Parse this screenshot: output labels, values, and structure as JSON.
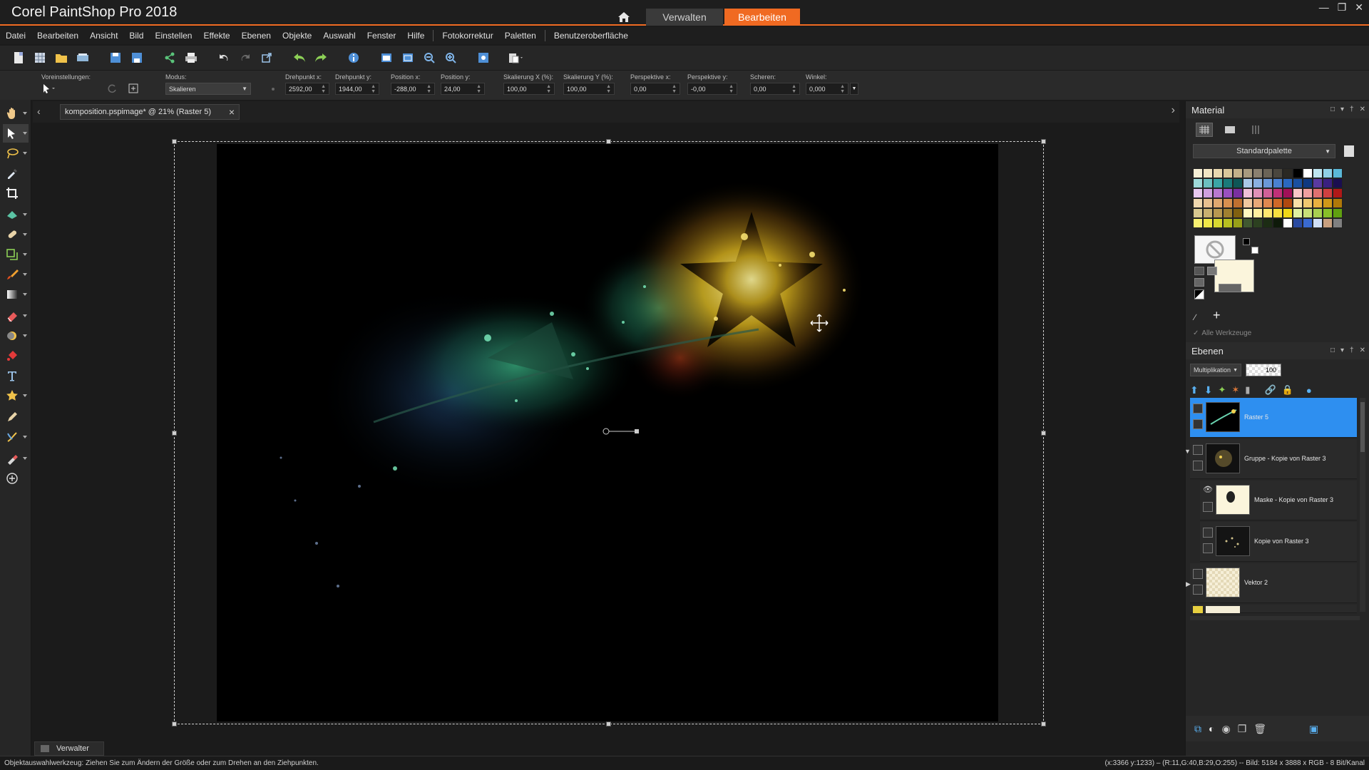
{
  "app": {
    "title": "Corel PaintShop Pro 2018",
    "tabs": [
      {
        "label": "Verwalten"
      },
      {
        "label": "Bearbeiten"
      }
    ],
    "accent_color": "#f06a22"
  },
  "menu": [
    "Datei",
    "Bearbeiten",
    "Ansicht",
    "Bild",
    "Einstellen",
    "Effekte",
    "Ebenen",
    "Objekte",
    "Auswahl",
    "Fenster",
    "Hilfe",
    "Fotokorrektur",
    "Paletten",
    "Benutzeroberfläche"
  ],
  "options": {
    "presets_label": "Voreinstellungen:",
    "mode_label": "Modus:",
    "mode_value": "Skalieren",
    "fields": [
      {
        "label": "Drehpunkt x:",
        "value": "2592,00"
      },
      {
        "label": "Drehpunkt y:",
        "value": "1944,00"
      },
      {
        "label": "Position x:",
        "value": "-288,00"
      },
      {
        "label": "Position y:",
        "value": "24,00"
      },
      {
        "label": "Skalierung X (%):",
        "value": "100,00"
      },
      {
        "label": "Skalierung Y (%):",
        "value": "100,00"
      },
      {
        "label": "Perspektive x:",
        "value": "0,00"
      },
      {
        "label": "Perspektive y:",
        "value": "-0,00"
      },
      {
        "label": "Scheren:",
        "value": "0,00"
      },
      {
        "label": "Winkel:",
        "value": "0,000"
      }
    ]
  },
  "document": {
    "tab_label": "komposition.pspimage* @  21% (Raster 5)"
  },
  "material": {
    "title": "Material",
    "palette_select": "Standardpalette",
    "all_tools_label": "Alle Werkzeuge"
  },
  "layers": {
    "title": "Ebenen",
    "blend_mode": "Multiplikation",
    "opacity": "100",
    "items": [
      {
        "name": "Raster 5",
        "active": true
      },
      {
        "name": "Gruppe - Kopie von Raster 3",
        "active": false
      },
      {
        "name": "Maske - Kopie von Raster 3",
        "active": false
      },
      {
        "name": "Kopie von Raster 3",
        "active": false
      },
      {
        "name": "Vektor 2",
        "active": false
      }
    ]
  },
  "bottom_tab": {
    "label": "Verwalter"
  },
  "status": {
    "left": "Objektauswahlwerkzeug: Ziehen Sie zum Ändern der Größe oder zum Drehen an den Ziehpunkten.",
    "right": "(x:3366 y:1233) – (R:11,G:40,B:29,O:255) -- Bild: 5184 x 3888 x RGB - 8 Bit/Kanal"
  }
}
